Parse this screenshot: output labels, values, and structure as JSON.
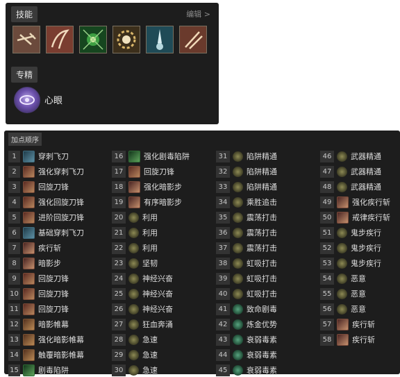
{
  "skills_panel": {
    "title": "技能",
    "edit_label": "编辑 >",
    "icons": [
      "crossbow-icon",
      "blade-slash-icon",
      "poison-trap-icon",
      "skull-gear-icon",
      "dagger-skull-icon",
      "twin-daggers-icon"
    ],
    "spec_title": "专精",
    "spec_name": "心眼"
  },
  "order_panel": {
    "title": "加点顺序",
    "columns": [
      [
        {
          "n": "1",
          "icon": "knife",
          "name": "穿刺飞刀"
        },
        {
          "n": "2",
          "icon": "blade",
          "name": "强化穿刺飞刀"
        },
        {
          "n": "3",
          "icon": "blade",
          "name": "回旋刀锋"
        },
        {
          "n": "4",
          "icon": "blade",
          "name": "强化回旋刀锋"
        },
        {
          "n": "5",
          "icon": "blade",
          "name": "进阶回旋刀锋"
        },
        {
          "n": "6",
          "icon": "knife",
          "name": "基础穿刺飞刀"
        },
        {
          "n": "7",
          "icon": "shadow",
          "name": "疾行斩"
        },
        {
          "n": "8",
          "icon": "shadow",
          "name": "暗影步"
        },
        {
          "n": "9",
          "icon": "blade",
          "name": "回旋刀锋"
        },
        {
          "n": "10",
          "icon": "blade",
          "name": "回旋刀锋"
        },
        {
          "n": "11",
          "icon": "blade",
          "name": "回旋刀锋"
        },
        {
          "n": "12",
          "icon": "stain",
          "name": "暗影帷幕"
        },
        {
          "n": "13",
          "icon": "stain",
          "name": "强化暗影帷幕"
        },
        {
          "n": "14",
          "icon": "stain",
          "name": "触覆暗影帷幕"
        },
        {
          "n": "15",
          "icon": "trap",
          "name": "剧毒陷阱"
        }
      ],
      [
        {
          "n": "16",
          "icon": "trap",
          "name": "强化剧毒陷阱"
        },
        {
          "n": "17",
          "icon": "blade",
          "name": "回旋刀锋"
        },
        {
          "n": "18",
          "icon": "shadow",
          "name": "强化暗影步"
        },
        {
          "n": "19",
          "icon": "shadow",
          "name": "有序暗影步"
        },
        {
          "n": "20",
          "icon": "passive",
          "name": "利用"
        },
        {
          "n": "21",
          "icon": "passive",
          "name": "利用"
        },
        {
          "n": "22",
          "icon": "passive",
          "name": "利用"
        },
        {
          "n": "23",
          "icon": "passive",
          "name": "坚韧"
        },
        {
          "n": "24",
          "icon": "passive",
          "name": "神经兴奋"
        },
        {
          "n": "25",
          "icon": "passive",
          "name": "神经兴奋"
        },
        {
          "n": "26",
          "icon": "passive",
          "name": "神经兴奋"
        },
        {
          "n": "27",
          "icon": "passive",
          "name": "狂血奔涌"
        },
        {
          "n": "28",
          "icon": "passive",
          "name": "急速"
        },
        {
          "n": "29",
          "icon": "passive",
          "name": "急速"
        },
        {
          "n": "30",
          "icon": "passive",
          "name": "急速"
        }
      ],
      [
        {
          "n": "31",
          "icon": "passive",
          "name": "陷阱精通"
        },
        {
          "n": "32",
          "icon": "passive",
          "name": "陷阱精通"
        },
        {
          "n": "33",
          "icon": "passive",
          "name": "陷阱精通"
        },
        {
          "n": "34",
          "icon": "passive",
          "name": "乘胜追击"
        },
        {
          "n": "35",
          "icon": "passive",
          "name": "震荡打击"
        },
        {
          "n": "36",
          "icon": "passive",
          "name": "震荡打击"
        },
        {
          "n": "37",
          "icon": "passive",
          "name": "震荡打击"
        },
        {
          "n": "38",
          "icon": "passive",
          "name": "虹吸打击"
        },
        {
          "n": "39",
          "icon": "passive",
          "name": "虹吸打击"
        },
        {
          "n": "40",
          "icon": "passive",
          "name": "虹吸打击"
        },
        {
          "n": "41",
          "icon": "teal",
          "name": "致命剧毒"
        },
        {
          "n": "42",
          "icon": "teal",
          "name": "炼金优势"
        },
        {
          "n": "43",
          "icon": "teal",
          "name": "衰弱毒素"
        },
        {
          "n": "44",
          "icon": "teal",
          "name": "衰弱毒素"
        },
        {
          "n": "45",
          "icon": "teal",
          "name": "衰弱毒素"
        }
      ],
      [
        {
          "n": "46",
          "icon": "passive",
          "name": "武器精通"
        },
        {
          "n": "47",
          "icon": "passive",
          "name": "武器精通"
        },
        {
          "n": "48",
          "icon": "passive",
          "name": "武器精通"
        },
        {
          "n": "49",
          "icon": "shadow",
          "name": "强化疾行斩"
        },
        {
          "n": "50",
          "icon": "shadow",
          "name": "戒律疾行斩"
        },
        {
          "n": "51",
          "icon": "passive",
          "name": "鬼步疾行"
        },
        {
          "n": "52",
          "icon": "passive",
          "name": "鬼步疾行"
        },
        {
          "n": "53",
          "icon": "passive",
          "name": "鬼步疾行"
        },
        {
          "n": "54",
          "icon": "passive",
          "name": "恶意"
        },
        {
          "n": "55",
          "icon": "passive",
          "name": "恶意"
        },
        {
          "n": "56",
          "icon": "passive",
          "name": "恶意"
        },
        {
          "n": "57",
          "icon": "shadow",
          "name": "疾行斩"
        },
        {
          "n": "58",
          "icon": "shadow",
          "name": "疾行斩"
        }
      ]
    ]
  }
}
